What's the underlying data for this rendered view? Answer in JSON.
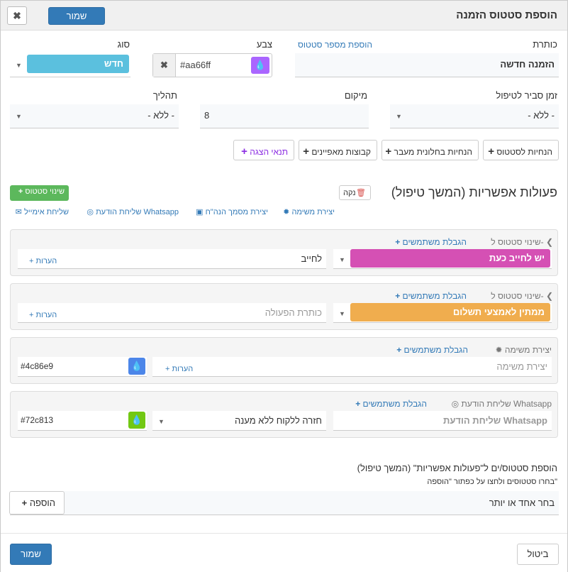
{
  "dialog": {
    "title": "הוספת סטטוס הזמנה",
    "save_label": "שמור",
    "close_glyph": "✖"
  },
  "form": {
    "title_label": "כותרת",
    "add_status_number_link": "הוספת מספר סטטוס",
    "title_value": "הזמנה חדשה",
    "color_label": "צבע",
    "color_value": "#aa66ff",
    "color_clear_glyph": "✖",
    "type_label": "סוג",
    "type_value": "חדש",
    "handling_time_label": "זמן סביר לטיפול",
    "handling_time_value": "- ללא -",
    "location_label": "מיקום",
    "location_value": "8",
    "process_label": "תהליך",
    "process_value": "- ללא -"
  },
  "toolbar": {
    "status_instructions": "הנחיות לסטטוס",
    "transition_instructions": "הנחיות בחלונית מעבר",
    "attribute_groups": "קבוצות מאפיינים",
    "display_conditions": "תנאי הצגה"
  },
  "actions_section": {
    "title": "פעולות אפשריות (המשך טיפול)",
    "clear_label": "נקה",
    "change_status_button": "שינוי סטטוס",
    "links": {
      "create_task": "יצירת משימה",
      "create_accounting_doc": "יצירת מסמך הנה\"ח",
      "send_whatsapp": "שליחת הודעת Whatsapp",
      "send_email": "שליחת אימייל"
    },
    "user_limit_label": "הגבלת משתמשים",
    "notes_label": "+ הערות",
    "cards": [
      {
        "type_label": "שינוי סטטוס ל-",
        "status_value": "יש לחייב כעת",
        "status_color": "#d550b4",
        "action_title": "לחייב"
      },
      {
        "type_label": "שינוי סטטוס ל-",
        "status_value": "ממתין לאמצעי תשלום",
        "status_color": "#f0ad4e",
        "action_title_placeholder": "כותרת הפעולה"
      },
      {
        "type_label": "יצירת משימה",
        "task_title_placeholder": "יצירת משימה",
        "color_value": "#4c86e9"
      },
      {
        "type_label": "שליחת הודעת Whatsapp",
        "message_placeholder": "שליחת הודעת Whatsapp",
        "template_value": "חזרה ללקוח ללא מענה",
        "color_value": "#72c813"
      }
    ]
  },
  "add_statuses": {
    "heading": "הוספת סטטוס/ים ל\"פעולות אפשריות\" (המשך טיפול)",
    "hint": "בחרו סטטוסים ולחצו על כפתור \"הוספה\"",
    "placeholder": "בחר אחד או יותר",
    "add_button": "הוספה"
  },
  "footer": {
    "cancel_label": "ביטול",
    "save_label": "שמור"
  },
  "colors": {
    "primary": "#337ab7",
    "type_pill": "#5bc0de",
    "color_swatch": "#aa66ff",
    "success": "#5cb85c",
    "purple_text": "#8a2be2"
  }
}
